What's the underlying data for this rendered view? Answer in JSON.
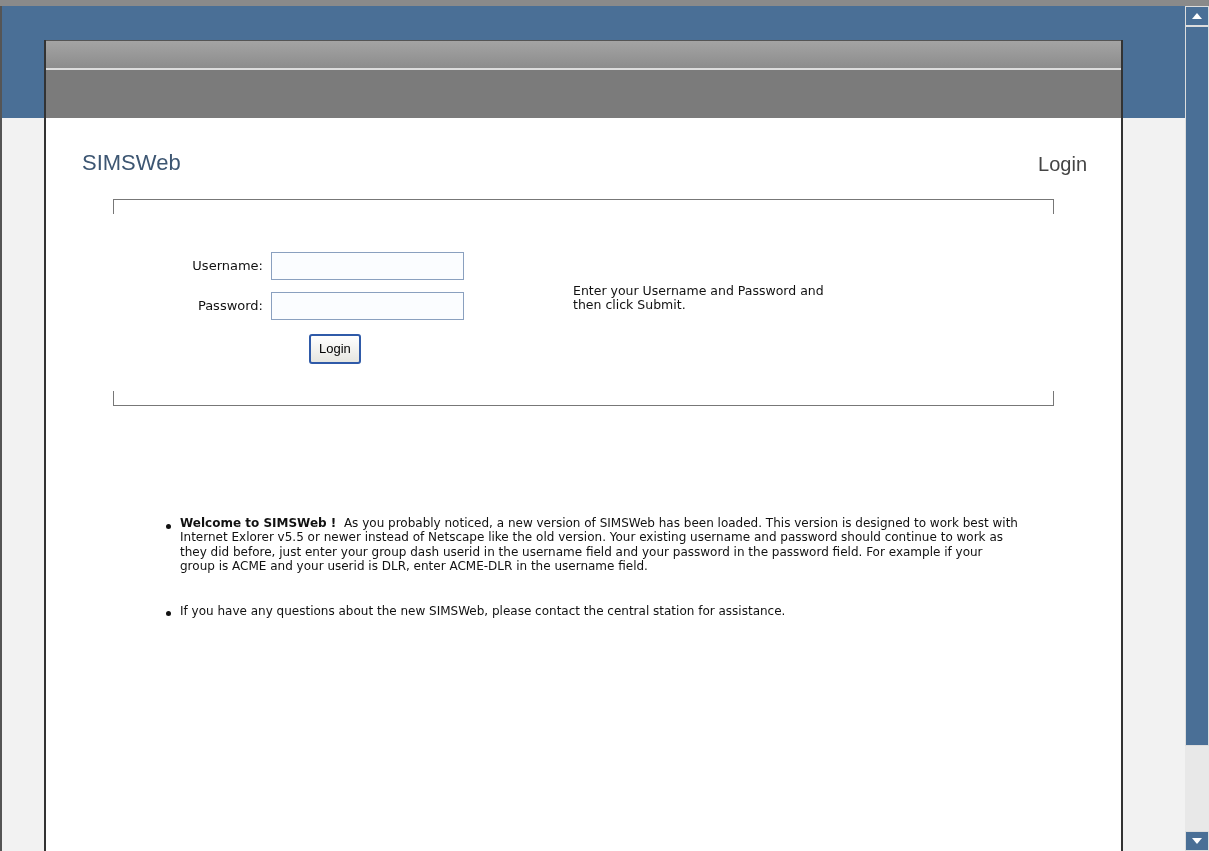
{
  "app": {
    "title": "SIMSWeb",
    "page_title": "Login"
  },
  "login_form": {
    "fields": [
      {
        "label": "Username:"
      },
      {
        "label": "Password:"
      }
    ],
    "submit": "Login",
    "hint": "Enter your Username and Password and then click Submit."
  },
  "notices": [
    "**Welcome to SIMSWeb !**  As you probably noticed, a new version of SIMSWeb has been loaded. This version is designed to work best with Internet Exlorer v5.5 or newer instead of Netscape like the old version. Your existing username and password should continue to work as they did before, just enter your group dash userid in the username field and your password in the password field. For example if your group is ACME and your userid is DLR, enter ACME-DLR in the username field.",
    "If you have any questions about the new SIMSWeb, please contact the central station for assistance."
  ]
}
